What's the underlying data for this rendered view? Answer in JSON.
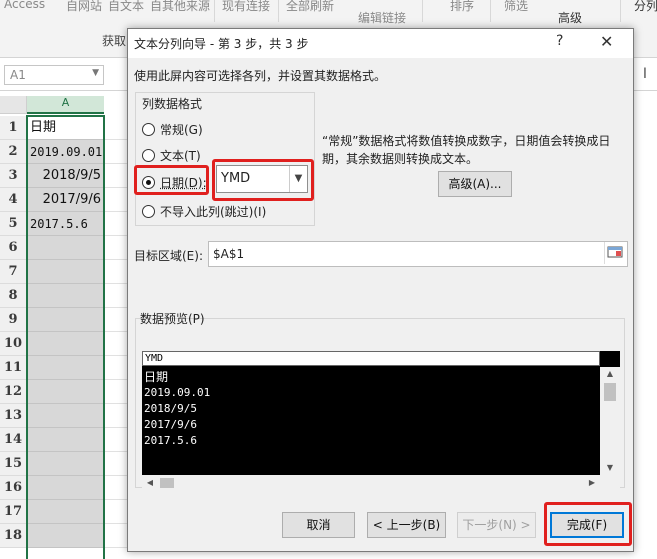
{
  "excel": {
    "ribbon_top": [
      "Access",
      "自网站",
      "自文本",
      "自其他来源",
      "现有连接",
      "全部刷新",
      "编辑链接",
      "排序",
      "筛选",
      "高级",
      "分列"
    ],
    "get_data_label": "获取",
    "name_box": "A1",
    "column_header": "A",
    "rows": [
      {
        "num": "1",
        "value": "日期"
      },
      {
        "num": "2",
        "value": "2019.09.01"
      },
      {
        "num": "3",
        "value": "2018/9/5"
      },
      {
        "num": "4",
        "value": "2017/9/6"
      },
      {
        "num": "5",
        "value": "2017.5.6"
      },
      {
        "num": "6",
        "value": ""
      },
      {
        "num": "7",
        "value": ""
      },
      {
        "num": "8",
        "value": ""
      },
      {
        "num": "9",
        "value": ""
      },
      {
        "num": "10",
        "value": ""
      },
      {
        "num": "11",
        "value": ""
      },
      {
        "num": "12",
        "value": ""
      },
      {
        "num": "13",
        "value": ""
      },
      {
        "num": "14",
        "value": ""
      },
      {
        "num": "15",
        "value": ""
      },
      {
        "num": "16",
        "value": ""
      },
      {
        "num": "17",
        "value": ""
      },
      {
        "num": "18",
        "value": ""
      }
    ]
  },
  "dialog": {
    "title": "文本分列向导 - 第 3 步，共 3 步",
    "help": "?",
    "close": "✕",
    "instruction": "使用此屏内容可选择各列，并设置其数据格式。",
    "group_label": "列数据格式",
    "radios": {
      "general": "常规(G)",
      "text": "文本(T)",
      "date": "日期(D):",
      "skip": "不导入此列(跳过)(I)"
    },
    "date_format": "YMD",
    "description": "“常规”数据格式将数值转换成数字，日期值会转换成日期，其余数据则转换成文本。",
    "advanced_button": "高级(A)...",
    "target_label": "目标区域(E):",
    "target_value": "$A$1",
    "preview_label": "数据预览(P)",
    "preview_header": "YMD",
    "preview_rows": [
      "日期",
      "2019.09.01",
      "2018/9/5",
      "2017/9/6",
      "2017.5.6"
    ],
    "buttons": {
      "cancel": "取消",
      "back": "< 上一步(B)",
      "next": "下一步(N) >",
      "finish": "完成(F)"
    }
  },
  "colors": {
    "highlight": "#e0201e",
    "selection": "#217346",
    "primary_focus": "#0078d7"
  }
}
